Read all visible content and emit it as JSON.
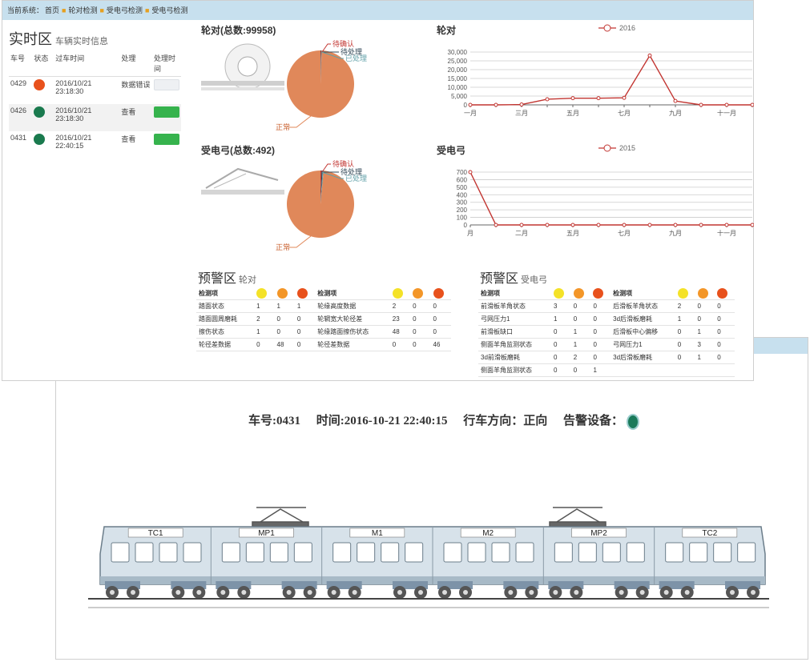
{
  "breadcrumb": {
    "prefix": "当前系统：",
    "items": [
      "首页",
      "轮对检测",
      "受电弓检测",
      "受电弓检测"
    ]
  },
  "realtime": {
    "title": "实时区",
    "subtitle": "车辆实时信息",
    "columns": [
      "车号",
      "状态",
      "过车时间",
      "处理",
      "处理时间"
    ],
    "rows": [
      {
        "car": "0429",
        "status_color": "#e8511c",
        "date": "2016/10/21",
        "time": "23:18:30",
        "action": "数据错误",
        "done": false
      },
      {
        "car": "0426",
        "status_color": "#1a7a4e",
        "date": "2016/10/21",
        "time": "23:18:30",
        "action": "查看",
        "done": true
      },
      {
        "car": "0431",
        "status_color": "#1a7a4e",
        "date": "2016/10/21",
        "time": "22:40:15",
        "action": "查看",
        "done": true
      }
    ]
  },
  "pie_wheel": {
    "title": "轮对(总数:99958)",
    "labels": [
      "待确认",
      "待处理",
      "已处理",
      "正常"
    ]
  },
  "pie_pantograph": {
    "title": "受电弓(总数:492)",
    "labels": [
      "待确认",
      "待处理",
      "已处理",
      "正常"
    ]
  },
  "line_wheel": {
    "title": "轮对"
  },
  "line_pantograph": {
    "title": "受电弓"
  },
  "chart_data": [
    {
      "type": "pie",
      "title": "轮对(总数:99958)",
      "labels": [
        "待确认",
        "待处理",
        "已处理",
        "正常"
      ],
      "values": [
        0.2,
        0.2,
        0.2,
        99.4
      ],
      "colors": [
        "#c23531",
        "#2f4554",
        "#61a0a8",
        "#e0885a"
      ]
    },
    {
      "type": "pie",
      "title": "受电弓(总数:492)",
      "labels": [
        "待确认",
        "待处理",
        "已处理",
        "正常"
      ],
      "values": [
        0.5,
        0.5,
        0.5,
        98.5
      ],
      "colors": [
        "#c23531",
        "#2f4554",
        "#61a0a8",
        "#e0885a"
      ]
    },
    {
      "type": "line",
      "title": "轮对",
      "legend": "2016",
      "x": [
        "一月",
        "二月",
        "三月",
        "四月",
        "五月",
        "六月",
        "七月",
        "八月",
        "九月",
        "十月",
        "十一月",
        "十二月"
      ],
      "x_tick_labels": [
        "一月",
        "",
        "三月",
        "",
        "五月",
        "",
        "七月",
        "",
        "九月",
        "",
        "十一月",
        ""
      ],
      "series": [
        {
          "name": "2016",
          "values": [
            0,
            0,
            200,
            3200,
            3800,
            3800,
            4000,
            28000,
            2200,
            0,
            0,
            0
          ]
        }
      ],
      "yticks": [
        "0",
        "5,000",
        "10,000",
        "15,000",
        "20,000",
        "25,000",
        "30,000"
      ],
      "ylim": [
        0,
        30000
      ],
      "color": "#c23531"
    },
    {
      "type": "line",
      "title": "受电弓",
      "legend": "2015",
      "x": [
        "一月",
        "二月",
        "三月",
        "四月",
        "五月",
        "六月",
        "七月",
        "八月",
        "九月",
        "十月",
        "十一月",
        "十二月"
      ],
      "x_tick_labels": [
        "月",
        "",
        "二月",
        "",
        "五月",
        "",
        "七月",
        "",
        "九月",
        "",
        "十一月",
        ""
      ],
      "series": [
        {
          "name": "2015",
          "values": [
            700,
            0,
            0,
            0,
            0,
            0,
            0,
            0,
            0,
            0,
            0,
            0
          ]
        }
      ],
      "yticks": [
        "0",
        "100",
        "200",
        "300",
        "400",
        "500",
        "600",
        "700"
      ],
      "ylim": [
        0,
        700
      ],
      "color": "#c23531"
    }
  ],
  "warn_wheel": {
    "title": "预警区",
    "subtitle": "轮对",
    "header": "检测项",
    "level_colors": [
      "#f4e228",
      "#f39628",
      "#e8511c"
    ],
    "left": [
      {
        "name": "踏面状态",
        "v": [
          "1",
          "1",
          "1"
        ]
      },
      {
        "name": "踏面圆周磨耗",
        "v": [
          "2",
          "0",
          "0"
        ]
      },
      {
        "name": "擦伤状态",
        "v": [
          "1",
          "0",
          "0"
        ]
      },
      {
        "name": "轮径差数据",
        "v": [
          "0",
          "48",
          "0"
        ]
      }
    ],
    "right": [
      {
        "name": "轮缘高度数据",
        "v": [
          "2",
          "0",
          "0"
        ]
      },
      {
        "name": "轮辋宽大轮径差",
        "v": [
          "23",
          "0",
          "0"
        ]
      },
      {
        "name": "轮缘踏面擦伤状态",
        "v": [
          "48",
          "0",
          "0"
        ]
      },
      {
        "name": "轮径差数据",
        "v": [
          "0",
          "0",
          "46"
        ]
      }
    ]
  },
  "warn_pantograph": {
    "title": "预警区",
    "subtitle": "受电弓",
    "header": "检测项",
    "level_colors": [
      "#f4e228",
      "#f39628",
      "#e8511c"
    ],
    "left": [
      {
        "name": "前滑板羊角状态",
        "v": [
          "3",
          "0",
          "0"
        ]
      },
      {
        "name": "弓网压力1",
        "v": [
          "1",
          "0",
          "0"
        ]
      },
      {
        "name": "前滑板缺口",
        "v": [
          "0",
          "1",
          "0"
        ]
      },
      {
        "name": "侧面羊角监测状态",
        "v": [
          "0",
          "1",
          "0"
        ]
      },
      {
        "name": "3d前滑板磨耗",
        "v": [
          "0",
          "2",
          "0"
        ]
      },
      {
        "name": "侧面羊角监测状态",
        "v": [
          "0",
          "0",
          "1"
        ]
      }
    ],
    "right": [
      {
        "name": "后滑板羊角状态",
        "v": [
          "2",
          "0",
          "0"
        ]
      },
      {
        "name": "3d后滑板磨耗",
        "v": [
          "1",
          "0",
          "0"
        ]
      },
      {
        "name": "后滑板中心偏移",
        "v": [
          "0",
          "1",
          "0"
        ]
      },
      {
        "name": "弓网压力1",
        "v": [
          "0",
          "3",
          "0"
        ]
      },
      {
        "name": "3d后滑板磨耗",
        "v": [
          "0",
          "1",
          "0"
        ]
      }
    ]
  },
  "car_info": {
    "car_no": "车号:0431",
    "time": "时间:2016-10-21 22:40:15",
    "direction": "行车方向：正向",
    "alarm_label": "告警设备："
  },
  "train_cars": [
    "TC1",
    "MP1",
    "M1",
    "M2",
    "MP2",
    "TC2"
  ]
}
